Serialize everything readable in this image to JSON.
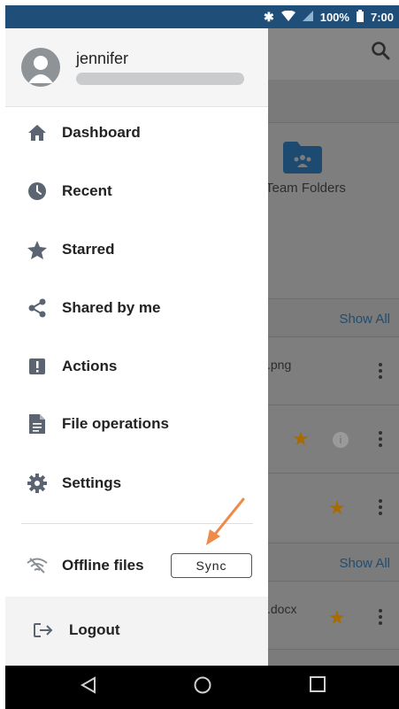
{
  "status_bar": {
    "battery": "100%",
    "time": "7:00"
  },
  "background": {
    "folder_label": "Team Folders",
    "show_all_1": "Show All",
    "show_all_2": "Show All",
    "file_1": ".png",
    "file_2": ".docx"
  },
  "drawer": {
    "username": "jennifer",
    "menu": [
      {
        "label": "Dashboard",
        "icon": "home-icon"
      },
      {
        "label": "Recent",
        "icon": "clock-icon"
      },
      {
        "label": "Starred",
        "icon": "star-icon"
      },
      {
        "label": "Shared by me",
        "icon": "share-icon"
      },
      {
        "label": "Actions",
        "icon": "alert-icon"
      },
      {
        "label": "File operations",
        "icon": "file-icon"
      },
      {
        "label": "Settings",
        "icon": "gear-icon"
      }
    ],
    "offline_label": "Offline files",
    "sync_label": "Sync",
    "logout_label": "Logout"
  },
  "colors": {
    "status_bar": "#1f4f78",
    "icon_gray": "#5b6470",
    "annotation_arrow": "#f08a4b",
    "star": "#a86b00"
  }
}
